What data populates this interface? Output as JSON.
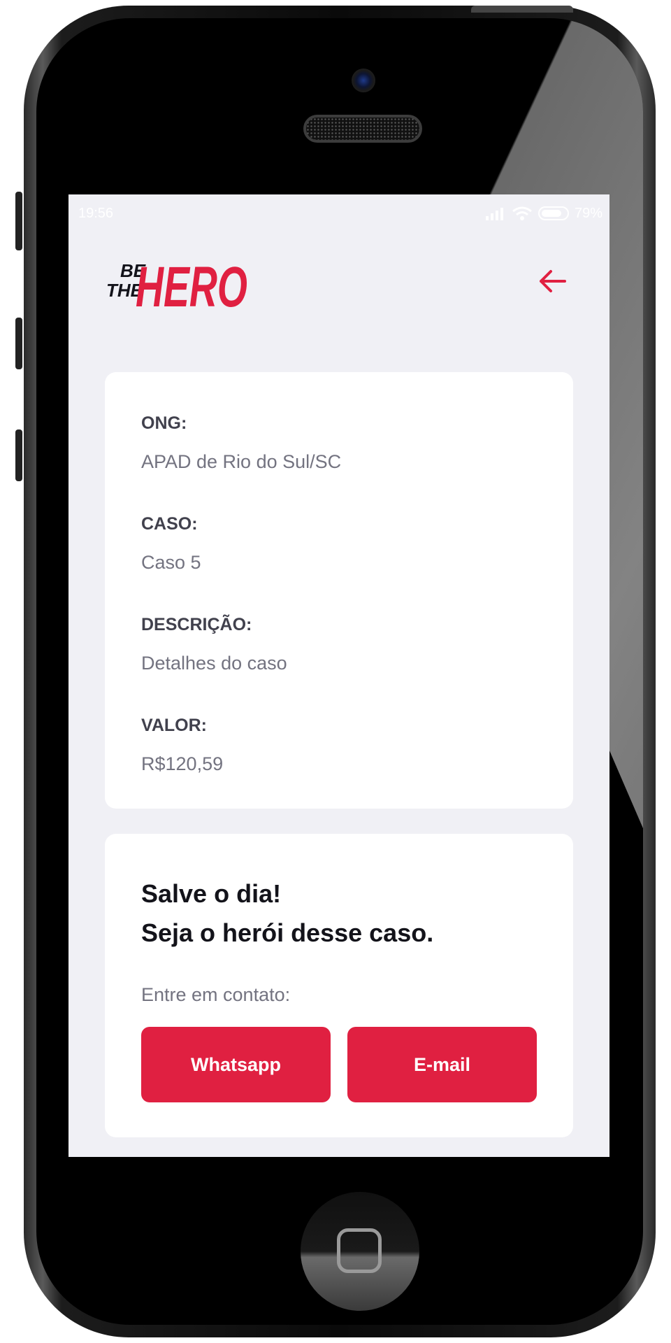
{
  "status_bar": {
    "time": "19:56",
    "battery": "79%"
  },
  "header": {
    "logo_top": "BE",
    "logo_bottom": "THE",
    "logo_main": "HERO"
  },
  "incident": {
    "ong_label": "ONG:",
    "ong_value": "APAD de Rio do Sul/SC",
    "case_label": "CASO:",
    "case_value": "Caso 5",
    "description_label": "DESCRIÇÃO:",
    "description_value": "Detalhes do caso",
    "value_label": "VALOR:",
    "value_value": "R$120,59"
  },
  "contact": {
    "title_line1": "Salve o dia!",
    "title_line2": "Seja o herói desse caso.",
    "prompt": "Entre em contato:",
    "whatsapp_label": "Whatsapp",
    "email_label": "E-mail"
  },
  "colors": {
    "accent": "#e02041",
    "background": "#f0f0f5"
  },
  "icons": {
    "back": "arrow-left-icon",
    "signal": "signal-icon",
    "wifi": "wifi-icon",
    "battery": "battery-icon"
  }
}
